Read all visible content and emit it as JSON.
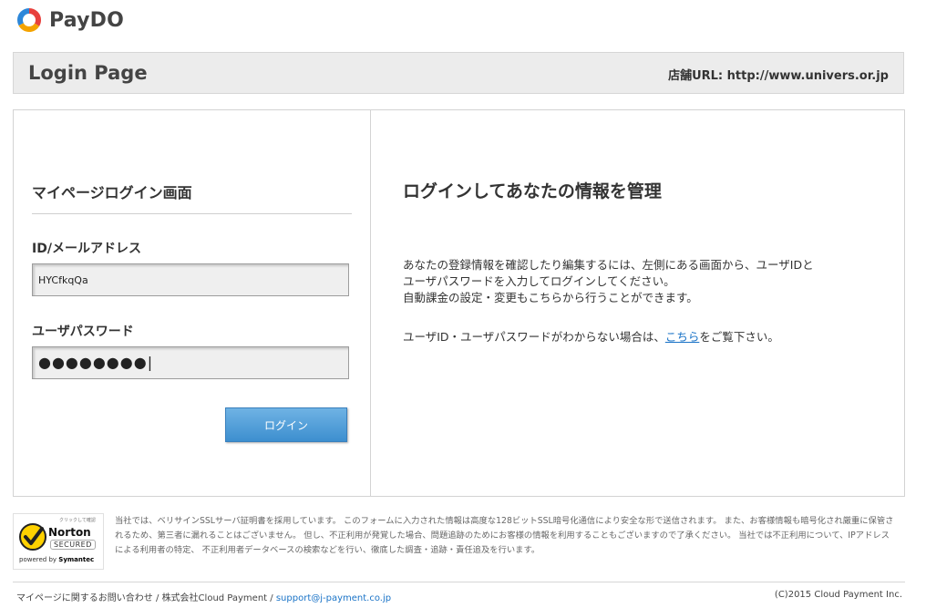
{
  "brand": {
    "name": "PayDO",
    "colors": {
      "red": "#e8403c",
      "orange": "#f4a300",
      "blue": "#2d87d9"
    }
  },
  "header": {
    "title": "Login Page",
    "shop_url": "店舗URL: http://www.univers.or.jp"
  },
  "login": {
    "heading": "マイページログイン画面",
    "id_label": "ID/メールアドレス",
    "id_value": "HYCfkqQa",
    "password_label": "ユーザパスワード",
    "password_value": "●●●●●●●●|",
    "button_label": "ログイン"
  },
  "info": {
    "heading": "ログインしてあなたの情報を管理",
    "paragraph_lines": [
      "あなたの登録情報を確認したり編集するには、左側にある画面から、ユーザIDと",
      "ユーザパスワードを入力してログインしてください。",
      "自動課金の設定・変更もこちらから行うことができます。"
    ],
    "help_before": "ユーザID・ユーザパスワードがわからない場合は、",
    "help_link": "こちら",
    "help_after": "をご覧下さい。"
  },
  "norton": {
    "small_text": "クリックして確認",
    "name": "Norton",
    "secured": "SECURED",
    "powered_prefix": "powered by ",
    "powered_brand": "Symantec"
  },
  "disclaimer": "当社では、ベリサインSSLサーバ証明書を採用しています。 このフォームに入力された情報は高度な128ビットSSL暗号化通信により安全な形で送信されます。 また、お客様情報も暗号化され厳重に保管されるため、第三者に漏れることはございません。 但し、不正利用が発覚した場合、問題追跡のためにお客様の情報を利用することもございますので了承ください。 当社では不正利用について、IPアドレスによる利用者の特定、 不正利用者データベースの検索などを行い、徹底した調査・追跡・責任追及を行います。",
  "footer": {
    "contact_text": "マイページに関するお問い合わせ",
    "company": "株式会社Cloud Payment",
    "separator": "/",
    "email": "support@j-payment.co.jp",
    "copyright": "(C)2015 Cloud Payment Inc."
  }
}
